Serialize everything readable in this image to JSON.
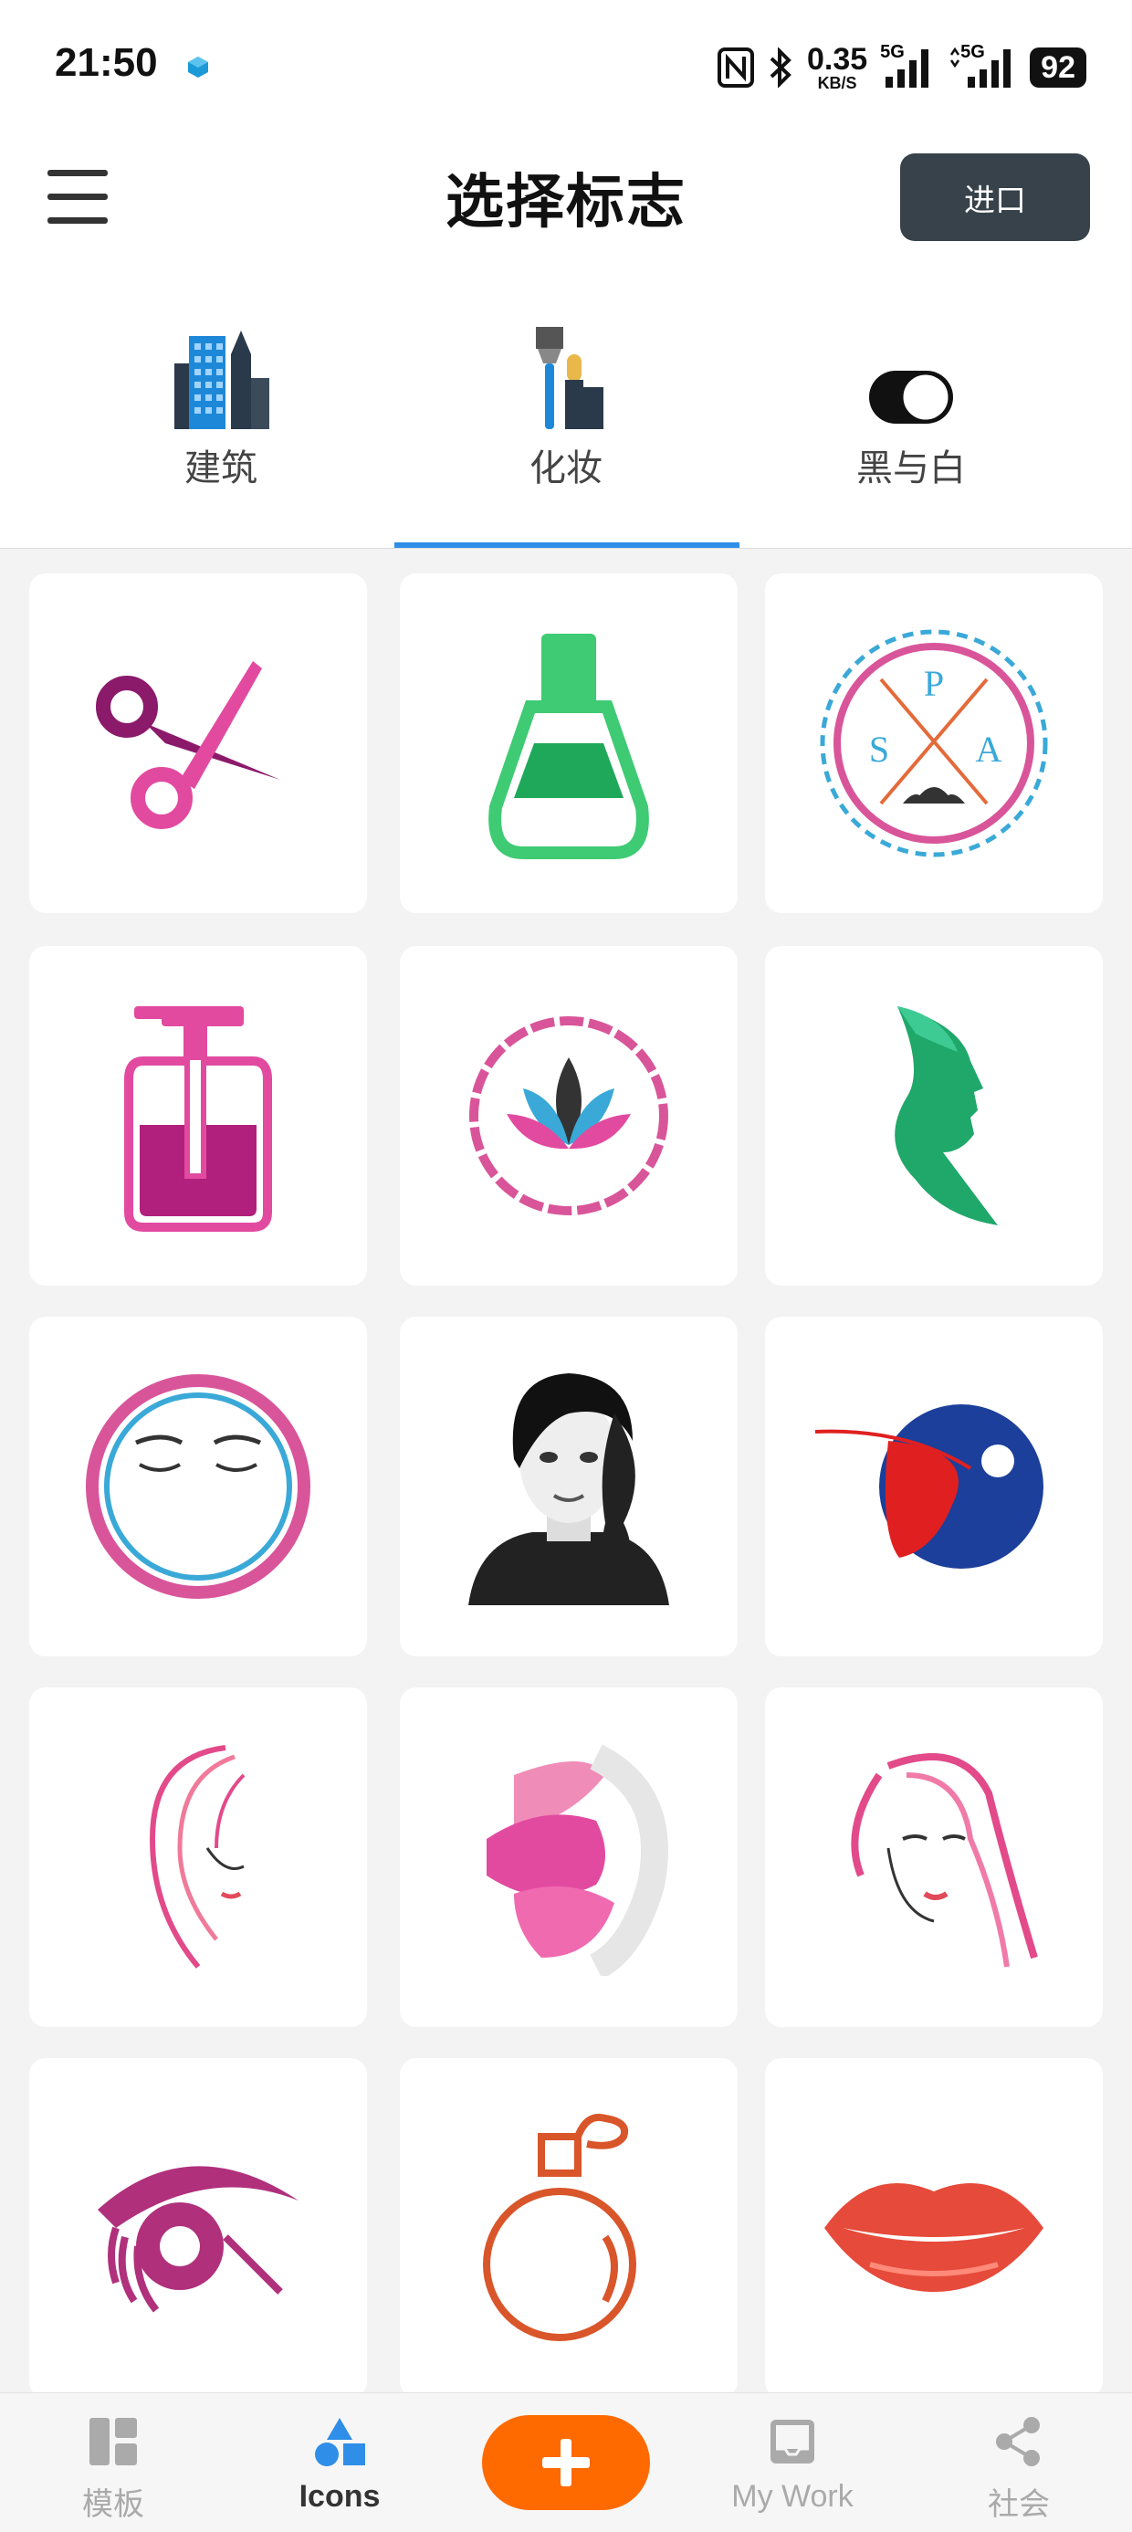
{
  "status_bar": {
    "time": "21:50",
    "net_speed_value": "0.35",
    "net_speed_unit": "KB/S",
    "network_1": "5G",
    "network_2": "5G",
    "battery": "92"
  },
  "header": {
    "title": "选择标志",
    "import_label": "进口"
  },
  "tabs": [
    {
      "label": "建筑",
      "icon": "buildings-icon"
    },
    {
      "label": "化妆",
      "icon": "makeup-icon",
      "active": true
    },
    {
      "label": "黑与白",
      "icon": "black-white-toggle-icon"
    }
  ],
  "logos": [
    {
      "name": "scissors-logo"
    },
    {
      "name": "nail-polish-logo"
    },
    {
      "name": "spa-badge-logo",
      "text": "SPA"
    },
    {
      "name": "soap-dispenser-logo"
    },
    {
      "name": "lotus-logo"
    },
    {
      "name": "green-face-profile-logo"
    },
    {
      "name": "closed-eyes-circle-logo"
    },
    {
      "name": "braided-woman-logo"
    },
    {
      "name": "swoosh-ball-logo"
    },
    {
      "name": "hair-line-woman-logo"
    },
    {
      "name": "pink-faces-logo"
    },
    {
      "name": "pink-hair-woman-logo"
    },
    {
      "name": "eyelash-logo"
    },
    {
      "name": "perfume-bottle-logo"
    },
    {
      "name": "lips-logo"
    }
  ],
  "bottom_nav": [
    {
      "label": "模板",
      "icon": "template-icon"
    },
    {
      "label": "Icons",
      "icon": "shapes-icon",
      "active": true
    },
    {
      "label": "",
      "icon": "plus-icon"
    },
    {
      "label": "My Work",
      "icon": "inbox-icon"
    },
    {
      "label": "社会",
      "icon": "share-icon"
    }
  ],
  "colors": {
    "accent_blue": "#2f8ee8",
    "fab_orange": "#ff6a00",
    "import_button": "#37424a"
  }
}
